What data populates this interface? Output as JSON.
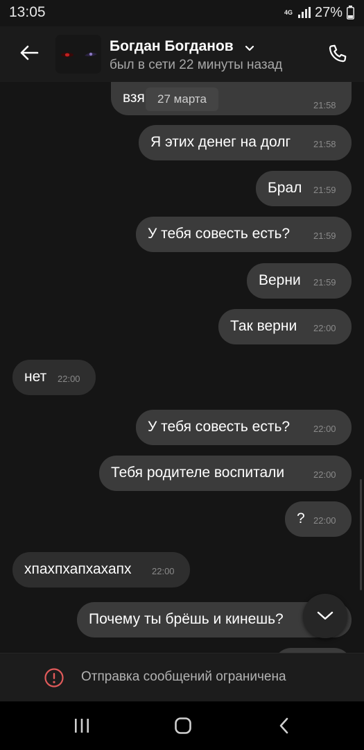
{
  "status_bar": {
    "time": "13:05",
    "network": "4G",
    "battery": "27%"
  },
  "header": {
    "contact_name": "Богдан Богданов",
    "last_seen": "был в сети 22 минуты назад"
  },
  "chat": {
    "date_chip": "27 марта",
    "partial_top": {
      "text": "взя",
      "time": "21:58"
    },
    "messages": [
      {
        "direction": "out",
        "text": "Я этих денег на долг",
        "time": "21:58"
      },
      {
        "direction": "out",
        "text": "Брал",
        "time": "21:59"
      },
      {
        "direction": "out",
        "text": "У тебя совесть есть?",
        "time": "21:59"
      },
      {
        "direction": "out",
        "text": "Верни",
        "time": "21:59"
      },
      {
        "direction": "out",
        "text": "Так верни",
        "time": "22:00"
      },
      {
        "direction": "in",
        "text": "нет",
        "time": "22:00"
      },
      {
        "direction": "out",
        "text": "У тебя совесть есть?",
        "time": "22:00"
      },
      {
        "direction": "out",
        "text": "Тебя родителе воспитали",
        "time": "22:00"
      },
      {
        "direction": "out",
        "text": "?",
        "time": "22:00"
      },
      {
        "direction": "in",
        "text": "хпахпхапхахапх",
        "time": "22:00"
      },
      {
        "direction": "out",
        "text": "Почему ты брёшь и кинешь?",
        "time": ""
      }
    ]
  },
  "restriction": {
    "text": "Отправка сообщений ограничена"
  },
  "icons": {
    "back": "arrow-left-icon",
    "call": "phone-icon",
    "scroll_down": "chevron-down-icon",
    "warning": "exclamation-circle-icon",
    "nav_recents": "recent-apps-icon",
    "nav_home": "home-icon",
    "nav_back": "back-chevron-icon"
  },
  "colors": {
    "background": "#151515",
    "outgoing_bubble": "#3b3b3b",
    "incoming_bubble": "#2e2e2e",
    "warning_red": "#e05a5a"
  }
}
